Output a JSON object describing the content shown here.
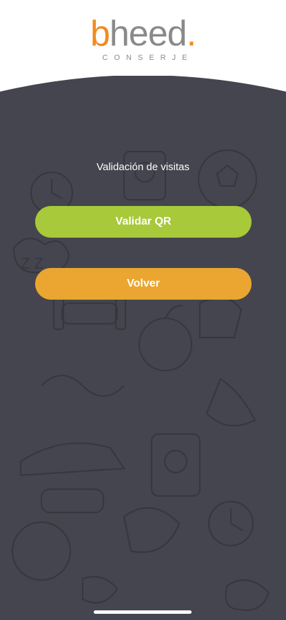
{
  "brand": {
    "name_prefix": "b",
    "name_rest": "heed",
    "name_dot": ".",
    "subtitle": "CONSERJE"
  },
  "screen": {
    "title": "Validación de visitas"
  },
  "actions": {
    "validate_qr_label": "Validar QR",
    "back_label": "Volver"
  },
  "colors": {
    "background": "#45454f",
    "brand_orange": "#f08c1e",
    "validate_green": "#a8c93a",
    "back_orange": "#eaa631"
  }
}
